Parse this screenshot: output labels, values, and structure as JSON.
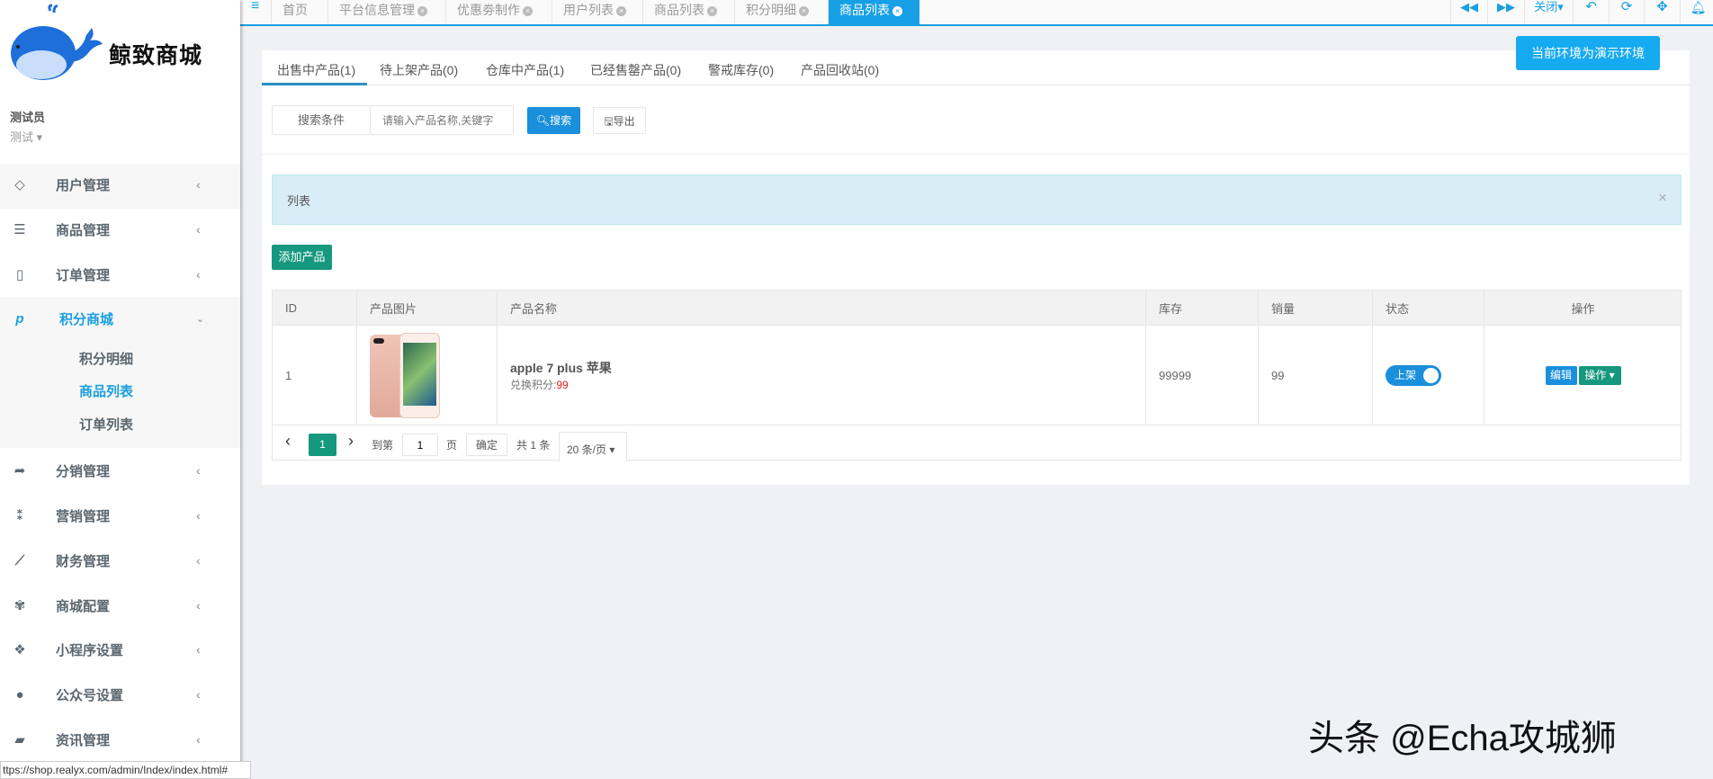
{
  "brand": {
    "name": "鲸致商城"
  },
  "user": {
    "name": "测试员",
    "role": "测试"
  },
  "sidebar": {
    "items": [
      {
        "label": "用户管理",
        "icon": "diamond-icon"
      },
      {
        "label": "商品管理",
        "icon": "list-icon"
      },
      {
        "label": "订单管理",
        "icon": "tablet-icon"
      },
      {
        "label": "积分商城",
        "icon": "pinterest-icon"
      },
      {
        "label": "分销管理",
        "icon": "share-icon"
      },
      {
        "label": "营销管理",
        "icon": "yelp-icon"
      },
      {
        "label": "财务管理",
        "icon": "line-chart-icon"
      },
      {
        "label": "商城配置",
        "icon": "plant-icon"
      },
      {
        "label": "小程序设置",
        "icon": "cubes-icon"
      },
      {
        "label": "公众号设置",
        "icon": "wechat-icon"
      },
      {
        "label": "资讯管理",
        "icon": "book-icon"
      }
    ],
    "sub_items": [
      "积分明细",
      "商品列表",
      "订单列表"
    ]
  },
  "topbar": {
    "tabs": [
      "首页",
      "平台信息管理",
      "优惠劵制作",
      "用户列表",
      "商品列表",
      "积分明细",
      "商品列表"
    ],
    "close_label": "关闭"
  },
  "env_button": "当前环境为演示环境",
  "product_tabs": [
    "出售中产品(1)",
    "待上架产品(0)",
    "仓库中产品(1)",
    "已经售罄产品(0)",
    "警戒库存(0)",
    "产品回收站(0)"
  ],
  "search": {
    "label": "搜索条件",
    "placeholder": "请输入产品名称,关键字",
    "search_btn": "搜索",
    "export_btn": "导出"
  },
  "alert": {
    "text": "列表",
    "close": "×"
  },
  "add_button": "添加产品",
  "table": {
    "headers": [
      "ID",
      "产品图片",
      "产品名称",
      "库存",
      "销量",
      "状态",
      "操作"
    ],
    "rows": [
      {
        "id": "1",
        "name": "apple 7 plus 苹果",
        "points_label": "兑换积分:",
        "points": "99",
        "stock": "99999",
        "sales": "99",
        "status": "上架",
        "edit": "编辑",
        "ops": "操作"
      }
    ]
  },
  "pagination": {
    "current": "1",
    "goto_label": "到第",
    "goto_value": "1",
    "page_label": "页",
    "confirm": "确定",
    "total": "共 1 条",
    "page_size": "20 条/页"
  },
  "status_url": "ttps://shop.realyx.com/admin/Index/index.html#",
  "watermark": "头条 @Echa攻城狮",
  "colors": {
    "primary": "#1a9fe0",
    "teal": "#16987e",
    "alert_bg": "#d9edf7"
  }
}
